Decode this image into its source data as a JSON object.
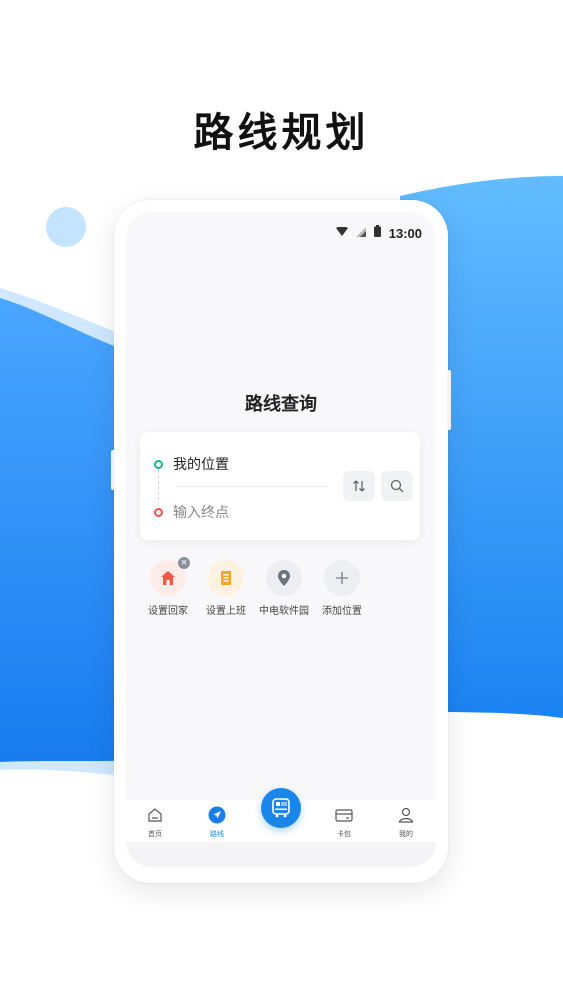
{
  "promo": {
    "title": "路线规划"
  },
  "status_bar": {
    "time": "13:00"
  },
  "route_query": {
    "heading": "路线查询",
    "from_text": "我的位置",
    "to_placeholder": "输入终点"
  },
  "quick_links": [
    {
      "label": "设置回家",
      "icon": "home-icon",
      "color": "#f25a46"
    },
    {
      "label": "设置上班",
      "icon": "office-building-icon",
      "color": "#f5a623"
    },
    {
      "label": "中电软件园",
      "icon": "location-pin-icon",
      "color": "#6b7380"
    },
    {
      "label": "添加位置",
      "icon": "plus-icon",
      "color": "#8b8f97"
    }
  ],
  "tabbar": {
    "items": [
      {
        "label": "首页",
        "icon": "home-outline-icon"
      },
      {
        "label": "路线",
        "icon": "navigation-arrow-icon"
      },
      {
        "label": "卡包",
        "icon": "wallet-card-icon"
      },
      {
        "label": "我的",
        "icon": "person-icon"
      }
    ],
    "center_icon": "bus-qr-icon",
    "active_label": "路线"
  },
  "colors": {
    "accent": "#1a86ea",
    "wave_light": "#5fb8ff",
    "wave_dark": "#1a7ef0",
    "start_dot": "#19b48b",
    "end_dot": "#ef5350"
  }
}
